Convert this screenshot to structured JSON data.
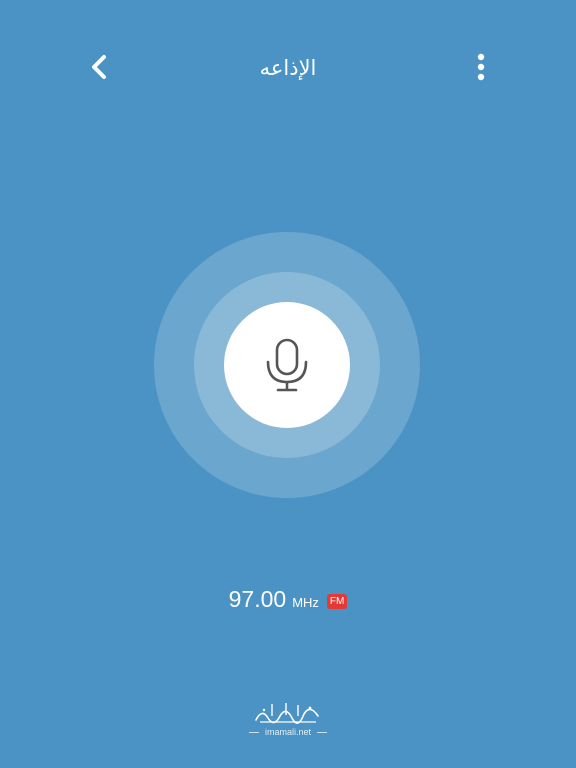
{
  "header": {
    "title": "الإذاعه",
    "back_icon": "chevron-left-icon",
    "menu_icon": "more-vertical-icon"
  },
  "player": {
    "mic_icon": "microphone-icon",
    "frequency": "97.00",
    "unit": "MHz",
    "band_badge": "FM"
  },
  "footer": {
    "logo_url": "imamali.net"
  },
  "colors": {
    "background": "#4A93C4",
    "badge": "#E53935",
    "icon": "#555555"
  }
}
